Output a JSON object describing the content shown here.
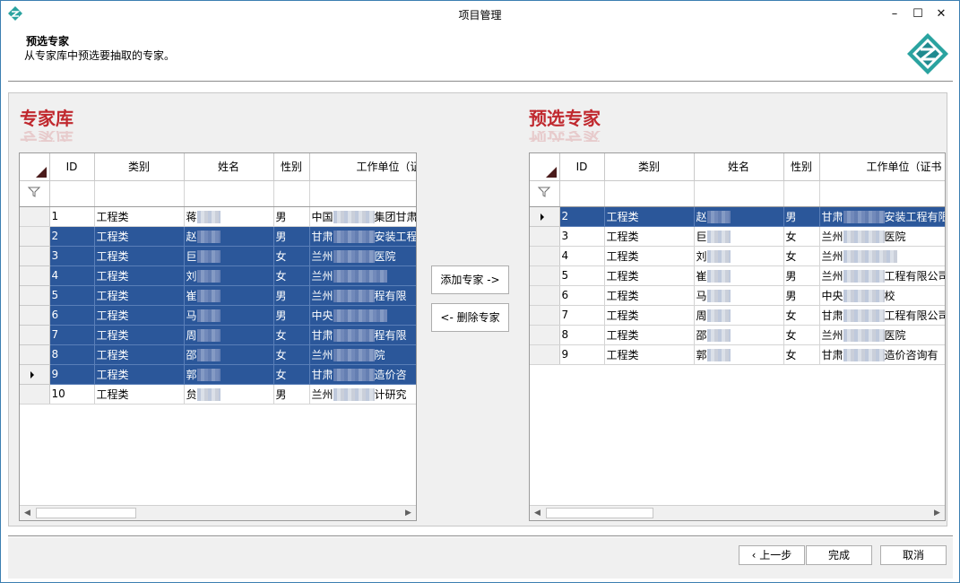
{
  "window": {
    "title": "项目管理",
    "controls": {
      "minimize": "–",
      "maximize": "☐",
      "close": "✕"
    }
  },
  "wizard": {
    "title": "预选专家",
    "subtitle": "从专家库中预选要抽取的专家。"
  },
  "left_panel": {
    "title": "专家库",
    "columns": [
      "ID",
      "类别",
      "姓名",
      "性别",
      "工作单位（证"
    ],
    "rows": [
      {
        "id": "1",
        "category": "工程类",
        "name": "蒋",
        "gender": "男",
        "unit_prefix": "中国",
        "unit_suffix": "集团甘肃",
        "selected": false
      },
      {
        "id": "2",
        "category": "工程类",
        "name": "赵",
        "gender": "男",
        "unit_prefix": "甘肃",
        "unit_suffix": "安装工程",
        "selected": true
      },
      {
        "id": "3",
        "category": "工程类",
        "name": "巨",
        "gender": "女",
        "unit_prefix": "兰州",
        "unit_suffix": "医院",
        "selected": true
      },
      {
        "id": "4",
        "category": "工程类",
        "name": "刘",
        "gender": "女",
        "unit_prefix": "兰州",
        "unit_suffix": "",
        "selected": true
      },
      {
        "id": "5",
        "category": "工程类",
        "name": "崔",
        "gender": "男",
        "unit_prefix": "兰州",
        "unit_suffix": "程有限",
        "selected": true
      },
      {
        "id": "6",
        "category": "工程类",
        "name": "马",
        "gender": "男",
        "unit_prefix": "中央",
        "unit_suffix": "",
        "selected": true
      },
      {
        "id": "7",
        "category": "工程类",
        "name": "周",
        "gender": "女",
        "unit_prefix": "甘肃",
        "unit_suffix": "程有限",
        "selected": true
      },
      {
        "id": "8",
        "category": "工程类",
        "name": "邵",
        "gender": "女",
        "unit_prefix": "兰州",
        "unit_suffix": "院",
        "selected": true
      },
      {
        "id": "9",
        "category": "工程类",
        "name": "郭",
        "gender": "女",
        "unit_prefix": "甘肃",
        "unit_suffix": "造价咨",
        "selected": true,
        "current": true
      },
      {
        "id": "10",
        "category": "工程类",
        "name": "贠",
        "gender": "男",
        "unit_prefix": "兰州",
        "unit_suffix": "计研究",
        "selected": false
      }
    ]
  },
  "right_panel": {
    "title": "预选专家",
    "columns": [
      "ID",
      "类别",
      "姓名",
      "性别",
      "工作单位（证书"
    ],
    "rows": [
      {
        "id": "2",
        "category": "工程类",
        "name": "赵",
        "gender": "男",
        "unit_prefix": "甘肃",
        "unit_suffix": "安装工程有限",
        "selected": true,
        "current": true
      },
      {
        "id": "3",
        "category": "工程类",
        "name": "巨",
        "gender": "女",
        "unit_prefix": "兰州",
        "unit_suffix": "医院",
        "selected": false
      },
      {
        "id": "4",
        "category": "工程类",
        "name": "刘",
        "gender": "女",
        "unit_prefix": "兰州",
        "unit_suffix": "",
        "selected": false
      },
      {
        "id": "5",
        "category": "工程类",
        "name": "崔",
        "gender": "男",
        "unit_prefix": "兰州",
        "unit_suffix": "工程有限公司",
        "selected": false
      },
      {
        "id": "6",
        "category": "工程类",
        "name": "马",
        "gender": "男",
        "unit_prefix": "中央",
        "unit_suffix": "校",
        "selected": false
      },
      {
        "id": "7",
        "category": "工程类",
        "name": "周",
        "gender": "女",
        "unit_prefix": "甘肃",
        "unit_suffix": "工程有限公司",
        "selected": false
      },
      {
        "id": "8",
        "category": "工程类",
        "name": "邵",
        "gender": "女",
        "unit_prefix": "兰州",
        "unit_suffix": "医院",
        "selected": false
      },
      {
        "id": "9",
        "category": "工程类",
        "name": "郭",
        "gender": "女",
        "unit_prefix": "甘肃",
        "unit_suffix": "造价咨询有",
        "selected": false
      }
    ]
  },
  "middle_buttons": {
    "add": "添加专家 ->",
    "remove": "<- 删除专家"
  },
  "footer": {
    "prev": "上一步",
    "finish": "完成",
    "cancel": "取消"
  },
  "icons": {
    "app": "app-logo-icon",
    "filter": "filter-icon",
    "logo": "brand-logo-icon"
  },
  "colors": {
    "selection": "#2b579a",
    "title_red": "#c0282e",
    "accent_teal": "#2aa3a0"
  }
}
